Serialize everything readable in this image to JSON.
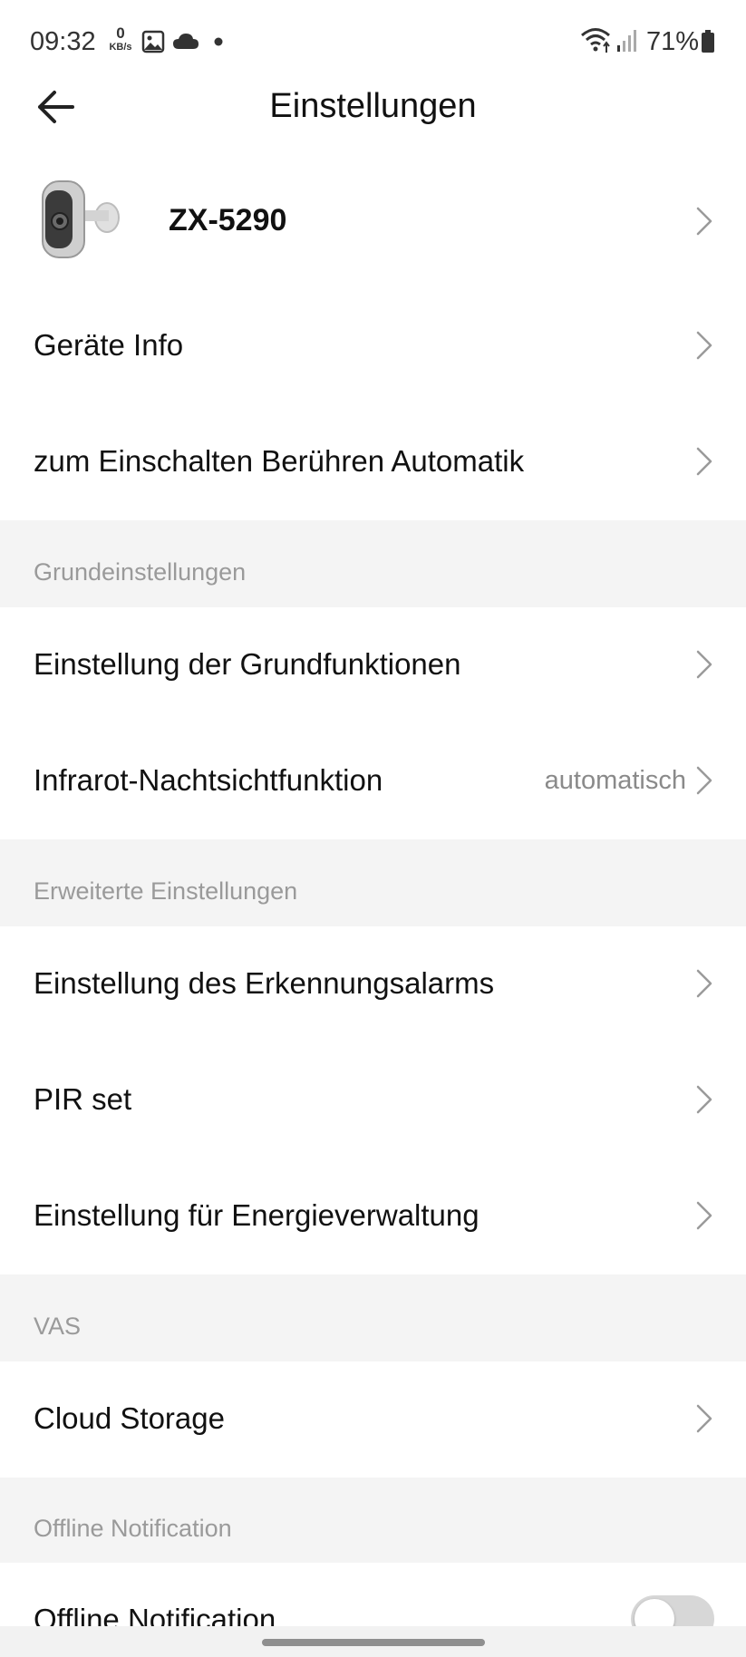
{
  "status_bar": {
    "time": "09:32",
    "net_speed_value": "0",
    "net_speed_unit": "KB/s",
    "battery_percent": "71%",
    "icons": [
      "image-icon",
      "cloud-icon",
      "dot-icon",
      "wifi-icon",
      "signal-icon",
      "battery-icon"
    ]
  },
  "header": {
    "title": "Einstellungen",
    "back_icon": "arrow-left-icon"
  },
  "device": {
    "name": "ZX-5290",
    "image": "camera-image"
  },
  "items": {
    "geraete_info": "Geräte Info",
    "automatik": "zum Einschalten Berühren Automatik",
    "grundfunktionen": "Einstellung der Grundfunktionen",
    "infrarot": "Infrarot-Nachtsichtfunktion",
    "infrarot_value": "automatisch",
    "erkennungsalarm": "Einstellung des Erkennungsalarms",
    "pir": "PIR set",
    "energie": "Einstellung für Energieverwaltung",
    "cloud": "Cloud Storage",
    "offline": "Offline Notification",
    "offline_enabled": false
  },
  "sections": {
    "grund": "Grundeinstellungen",
    "erweitert": "Erweiterte Einstellungen",
    "vas": "VAS",
    "offline": "Offline Notification"
  }
}
